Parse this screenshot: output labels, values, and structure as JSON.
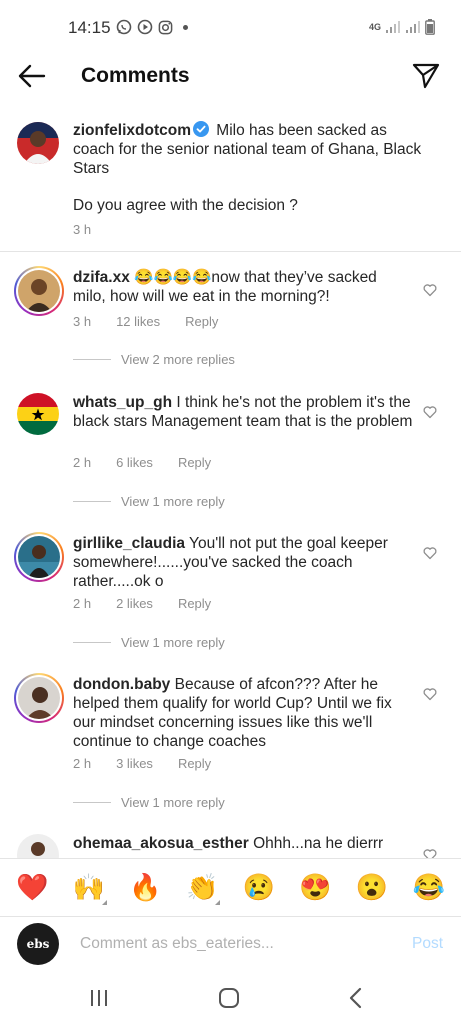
{
  "status_bar": {
    "time": "14:15",
    "network": "4G"
  },
  "header": {
    "title": "Comments"
  },
  "caption": {
    "username": "zionfelixdotcom",
    "text": "Milo has been sacked as coach for the senior national team of Ghana, Black Stars",
    "question": "Do you agree with the decision ?",
    "time": "3 h"
  },
  "comments": [
    {
      "username": "dzifa.xx",
      "emoji_prefix": "😂😂😂😂",
      "text": "now that they’ve sacked milo, how will we eat in the morning?!",
      "time": "3 h",
      "likes": "12 likes",
      "reply": "Reply",
      "view_replies": "View 2 more replies"
    },
    {
      "username": "whats_up_gh",
      "text": "I think he's not the problem  it's the black stars Management team that is the problem",
      "time": "2 h",
      "likes": "6 likes",
      "reply": "Reply",
      "view_replies": "View 1 more reply"
    },
    {
      "username": "girllike_claudia",
      "text": "You'll not put the goal keeper somewhere!......you've sacked the coach rather.....ok o",
      "time": "2 h",
      "likes": "2 likes",
      "reply": "Reply",
      "view_replies": "View 1 more reply"
    },
    {
      "username": "dondon.baby",
      "text": "Because of afcon??? After he helped them qualify for world Cup? Until we fix our mindset concerning issues like this we'll continue to change coaches",
      "time": "2 h",
      "likes": "3 likes",
      "reply": "Reply",
      "view_replies": "View 1 more reply"
    },
    {
      "username": "ohemaa_akosua_esther",
      "text": "Ohhh...na he dierrr"
    }
  ],
  "reactions": [
    "❤️",
    "🙌",
    "🔥",
    "👏",
    "😢",
    "😍",
    "😮",
    "😂"
  ],
  "input": {
    "placeholder": "Comment as ebs_eateries...",
    "post_label": "Post",
    "avatar_text": "ebs"
  },
  "colors": {
    "post": "#b3dbff",
    "verified": "#3897f0",
    "meta": "#8e8e8e"
  }
}
